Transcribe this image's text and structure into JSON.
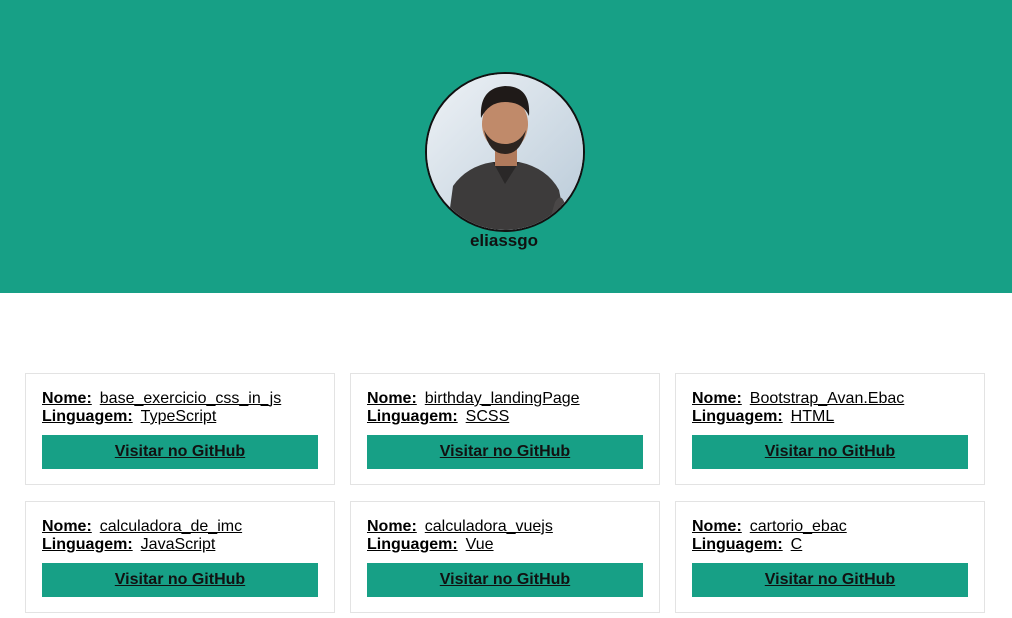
{
  "theme": {
    "accent": "#17a086"
  },
  "profile": {
    "username": "eliassgo",
    "avatar_icon": "profile-photo"
  },
  "labels": {
    "name": "Nome:",
    "language": "Linguagem:",
    "visit": "Visitar no GitHub"
  },
  "repos": [
    {
      "name": "base_exercicio_css_in_js",
      "language": "TypeScript"
    },
    {
      "name": "birthday_landingPage",
      "language": "SCSS"
    },
    {
      "name": "Bootstrap_Avan.Ebac",
      "language": "HTML"
    },
    {
      "name": "calculadora_de_imc",
      "language": "JavaScript"
    },
    {
      "name": "calculadora_vuejs",
      "language": "Vue"
    },
    {
      "name": "cartorio_ebac",
      "language": "C"
    }
  ]
}
